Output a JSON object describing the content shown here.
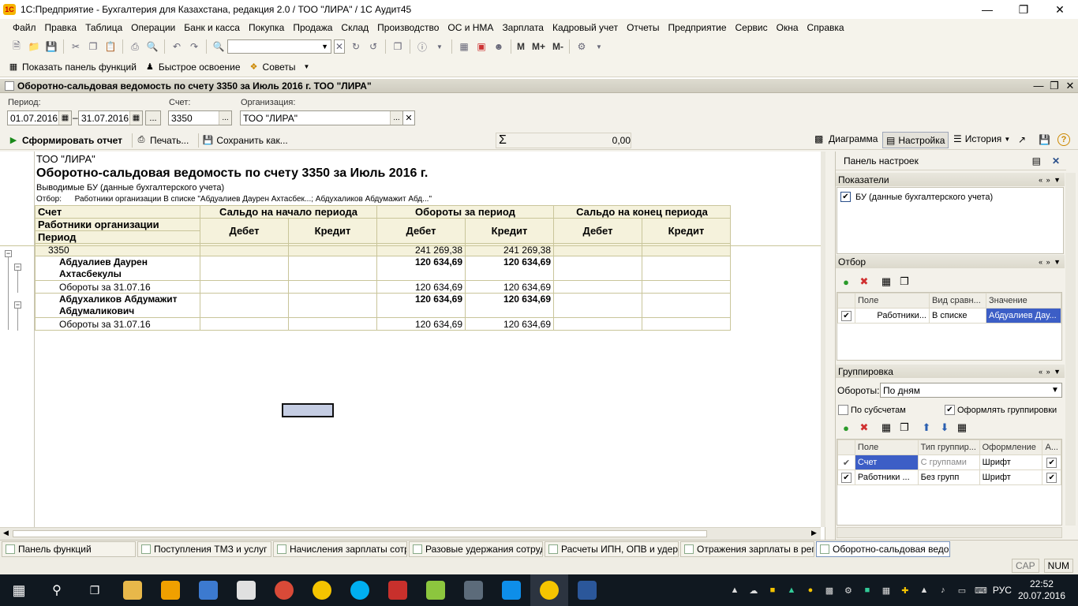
{
  "window": {
    "title": "1С:Предприятие - Бухгалтерия для Казахстана, редакция 2.0 / ТОО \"ЛИРА\" / 1С Аудит45",
    "logo": "1С"
  },
  "menu": [
    "Файл",
    "Правка",
    "Таблица",
    "Операции",
    "Банк и касса",
    "Покупка",
    "Продажа",
    "Склад",
    "Производство",
    "ОС и НМА",
    "Зарплата",
    "Кадровый учет",
    "Отчеты",
    "Предприятие",
    "Сервис",
    "Окна",
    "Справка"
  ],
  "toolbar": {
    "m": "M",
    "mplus": "M+",
    "mminus": "M-"
  },
  "funcbar": {
    "show_panel": "Показать панель функций",
    "quick_learn": "Быстрое освоение",
    "tips": "Советы"
  },
  "doc": {
    "title": "Оборотно-сальдовая ведомость по счету 3350 за Июль 2016 г. ТОО \"ЛИРА\"",
    "period_label": "Период:",
    "period_from": "01.07.2016",
    "period_dash": "–",
    "period_to": "31.07.2016",
    "account_label": "Счет:",
    "account": "3350",
    "org_label": "Организация:",
    "org": "ТОО \"ЛИРА\"",
    "ellipsis": "...",
    "generate": "Сформировать отчет",
    "print": "Печать...",
    "save_as": "Сохранить как...",
    "sum_symbol": "Σ",
    "sum_value": "0,00",
    "diagram": "Диаграмма",
    "settings": "Настройка",
    "history": "История"
  },
  "report": {
    "org": "ТОО \"ЛИРА\"",
    "title": "Оборотно-сальдовая ведомость по счету 3350 за Июль 2016 г.",
    "shown": "Выводимые БУ (данные бухгалтерского учета)",
    "filter": "Отбор:      Работники организации В списке \"Абдуалиев Даурен Ахтасбек...; Абдухаликов Абдумажит Абд...\"",
    "headers": {
      "account": "Счет",
      "employees": "Работники организации",
      "period": "Период",
      "opening": "Сальдо на начало периода",
      "turnover": "Обороты за период",
      "closing": "Сальдо на конец периода",
      "debit": "Дебет",
      "credit": "Кредит"
    },
    "rows": [
      {
        "name": "3350",
        "td": "241 269,38",
        "tc": "241 269,38"
      },
      {
        "name": "Абдуалиев Даурен Ахтасбекулы",
        "td": "120 634,69",
        "tc": "120 634,69"
      },
      {
        "name": "Обороты за 31.07.16",
        "td": "120 634,69",
        "tc": "120 634,69"
      },
      {
        "name": "Абдухаликов Абдумажит Абдумаликович",
        "td": "120 634,69",
        "tc": "120 634,69"
      },
      {
        "name": "Обороты за 31.07.16",
        "td": "120 634,69",
        "tc": "120 634,69"
      }
    ]
  },
  "panel": {
    "title": "Панель настроек",
    "indicators": "Показатели",
    "indicator_item": "БУ (данные бухгалтерского учета)",
    "filter": "Отбор",
    "filter_cols": [
      "Поле",
      "Вид сравн...",
      "Значение"
    ],
    "filter_row": [
      "Работники...",
      "В списке",
      "Абдуалиев Дау..."
    ],
    "grouping": "Группировка",
    "turnovers_label": "Обороты:",
    "turnovers_value": "По дням",
    "by_subaccounts": "По субсчетам",
    "format_groups": "Оформлять группировки",
    "group_cols": [
      "Поле",
      "Тип группир...",
      "Оформление",
      "А..."
    ],
    "group_rows": [
      [
        "Счет",
        "С группами",
        "Шрифт"
      ],
      [
        "Работники ...",
        "Без групп",
        "Шрифт"
      ]
    ]
  },
  "tabs": [
    "Панель функций",
    "Поступления ТМЗ и услуг",
    "Начисления зарплаты сотр...",
    "Разовые удержания сотруд...",
    "Расчеты ИПН, ОПВ и удер...",
    "Отражения зарплаты в рег...",
    "Оборотно-сальдовая ведом..."
  ],
  "status": {
    "cap": "CAP",
    "num": "NUM"
  },
  "taskbar": {
    "lang": "РУС",
    "time": "22:52",
    "date": "20.07.2016"
  }
}
